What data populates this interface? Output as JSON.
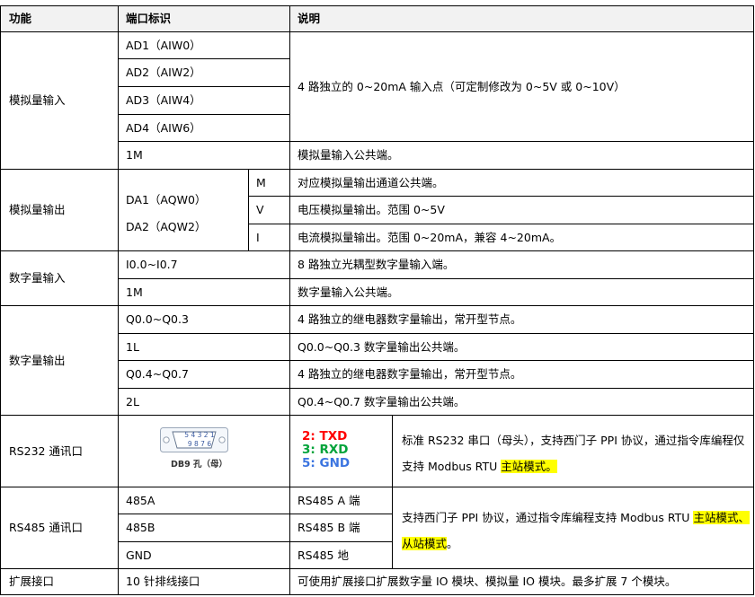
{
  "header": {
    "func": "功能",
    "port": "端口标识",
    "desc": "说明"
  },
  "analog_in": {
    "func": "模拟量输入",
    "ports": [
      "AD1（AIW0）",
      "AD2（AIW2）",
      "AD3（AIW4）",
      "AD4（AIW6）"
    ],
    "desc": "4 路独立的 0~20mA 输入点（可定制修改为 0~5V 或 0~10V）",
    "common_port": "1M",
    "common_desc": "模拟量输入公共端。"
  },
  "analog_out": {
    "func": "模拟量输出",
    "ports": [
      "DA1（AQW0）",
      "DA2（AQW2）"
    ],
    "sub": [
      {
        "label": "M",
        "desc": "对应模拟量输出通道公共端。"
      },
      {
        "label": "V",
        "desc": "电压模拟量输出。范围 0~5V"
      },
      {
        "label": "I",
        "desc": "电流模拟量输出。范围 0~20mA，兼容 4~20mA。"
      }
    ]
  },
  "digital_in": {
    "func": "数字量输入",
    "rows": [
      {
        "port": "I0.0~I0.7",
        "desc": "8 路独立光耦型数字量输入端。"
      },
      {
        "port": "1M",
        "desc": "数字量输入公共端。"
      }
    ]
  },
  "digital_out": {
    "func": "数字量输出",
    "rows": [
      {
        "port": "Q0.0~Q0.3",
        "desc": "4 路独立的继电器数字量输出，常开型节点。"
      },
      {
        "port": "1L",
        "desc": "Q0.0~Q0.3 数字量输出公共端。"
      },
      {
        "port": "Q0.4~Q0.7",
        "desc": "4 路独立的继电器数字量输出，常开型节点。"
      },
      {
        "port": "2L",
        "desc": "Q0.4~Q0.7 数字量输出公共端。"
      }
    ]
  },
  "rs232": {
    "func": "RS232 通讯口",
    "connector": {
      "top_pins": "5 4 3 2 1",
      "bottom_pins": "9 8 7 6",
      "label": "DB9 孔（母）"
    },
    "signals": [
      {
        "num": "2:",
        "name": "TXD",
        "color": "#ff0000"
      },
      {
        "num": "3:",
        "name": "RXD",
        "color": "#00a33a"
      },
      {
        "num": "5:",
        "name": "GND",
        "color": "#3b74e0"
      }
    ],
    "desc_line1": "标准 RS232 串口（母头），支持西门子 PPI 协议，通过指令库编程仅",
    "desc_line2_prefix": "支持 Modbus RTU ",
    "desc_line2_hl": "主站模式。"
  },
  "rs485": {
    "func": "RS485 通讯口",
    "rows": [
      {
        "port": "485A",
        "signal": "RS485 A 端"
      },
      {
        "port": "485B",
        "signal": "RS485 B 端"
      },
      {
        "port": "GND",
        "signal": "RS485 地"
      }
    ],
    "desc_line1_prefix": "支持西门子 PPI 协议，通过指令库编程支持 Modbus RTU ",
    "desc_line1_hl": "主站模式、",
    "desc_line2_hl": "从站模式",
    "desc_line2_suffix": "。"
  },
  "expansion": {
    "func": "扩展接口",
    "port": "10 针排线接口",
    "desc": "可使用扩展接口扩展数字量 IO 模块、模拟量 IO 模块。最多扩展 7 个模块。"
  }
}
